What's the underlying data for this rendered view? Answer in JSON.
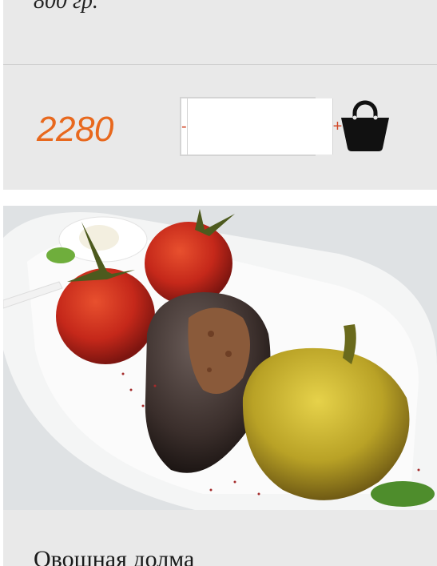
{
  "prev_item": {
    "weight": "800 гр."
  },
  "buy": {
    "price": "2280",
    "minus_label": "-",
    "plus_label": "+",
    "quantity": "",
    "cart_icon": "shopping-bag-icon"
  },
  "item": {
    "photo_icon": "dish-photo",
    "name": "Овощная долма"
  },
  "colors": {
    "price": "#e8681d",
    "stepper": "#d24a2a",
    "card_bg": "#e9e9e9"
  }
}
